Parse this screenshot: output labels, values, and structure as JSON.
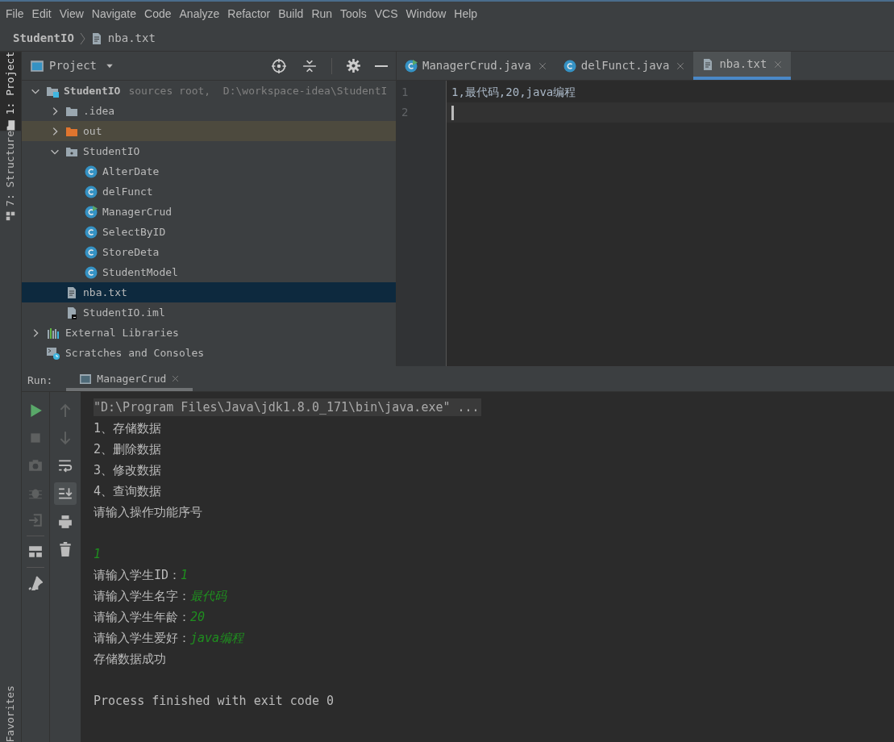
{
  "menu": [
    "File",
    "Edit",
    "View",
    "Navigate",
    "Code",
    "Analyze",
    "Refactor",
    "Build",
    "Run",
    "Tools",
    "VCS",
    "Window",
    "Help"
  ],
  "breadcrumb": {
    "project": "StudentIO",
    "file": "nba.txt"
  },
  "left_strip": [
    {
      "label": "1: Project",
      "selected": true
    },
    {
      "label": "7: Structure",
      "selected": false
    }
  ],
  "favorites": "Favorites",
  "project_panel": {
    "title": "Project",
    "tree": [
      {
        "kind": "module",
        "label": "StudentIO",
        "hint": "sources root,  D:\\workspace-idea\\StudentI",
        "expanded": true,
        "selected": false,
        "children": [
          {
            "kind": "folder",
            "label": ".idea",
            "expanded": false,
            "selected": false
          },
          {
            "kind": "excluded",
            "label": "out",
            "expanded": false,
            "selected": false
          },
          {
            "kind": "source",
            "label": "StudentIO",
            "expanded": true,
            "selected": false,
            "children": [
              {
                "kind": "class",
                "label": "AlterDate",
                "selected": false
              },
              {
                "kind": "class",
                "label": "delFunct",
                "selected": false
              },
              {
                "kind": "main",
                "label": "ManagerCrud",
                "selected": false
              },
              {
                "kind": "class",
                "label": "SelectByID",
                "selected": false
              },
              {
                "kind": "class",
                "label": "StoreDeta",
                "selected": false
              },
              {
                "kind": "class",
                "label": "StudentModel",
                "selected": false
              }
            ]
          },
          {
            "kind": "text",
            "label": "nba.txt",
            "selected": true
          },
          {
            "kind": "iml",
            "label": "StudentIO.iml",
            "selected": false
          }
        ]
      },
      {
        "kind": "libraries",
        "label": "External Libraries",
        "expanded": false,
        "selected": false
      },
      {
        "kind": "scratches",
        "label": "Scratches and Consoles",
        "selected": false
      }
    ]
  },
  "editor": {
    "tabs": [
      {
        "kind": "main",
        "label": "ManagerCrud.java",
        "selected": false
      },
      {
        "kind": "class",
        "label": "delFunct.java",
        "selected": false
      },
      {
        "kind": "text",
        "label": "nba.txt",
        "selected": true
      }
    ],
    "lines": [
      {
        "number": "1",
        "text": "1,最代码,20,java编程"
      },
      {
        "number": "2"
      }
    ]
  },
  "run_panel": {
    "label": "Run:",
    "tab": "ManagerCrud",
    "console": [
      [
        {
          "kind": "command",
          "text": "\"D:\\Program Files\\Java\\jdk1.8.0_171\\bin\\java.exe\" ..."
        }
      ],
      [
        {
          "kind": "output",
          "text": "1、存储数据"
        }
      ],
      [
        {
          "kind": "output",
          "text": "2、删除数据"
        }
      ],
      [
        {
          "kind": "output",
          "text": "3、修改数据"
        }
      ],
      [
        {
          "kind": "output",
          "text": "4、查询数据"
        }
      ],
      [
        {
          "kind": "output",
          "text": "请输入操作功能序号"
        }
      ],
      [
        {
          "kind": "blank"
        }
      ],
      [
        {
          "kind": "input",
          "text": "1"
        }
      ],
      [
        {
          "kind": "output",
          "text": "请输入学生ID："
        },
        {
          "kind": "input",
          "text": "1"
        }
      ],
      [
        {
          "kind": "output",
          "text": "请输入学生名字："
        },
        {
          "kind": "input",
          "text": "最代码"
        }
      ],
      [
        {
          "kind": "output",
          "text": "请输入学生年龄："
        },
        {
          "kind": "input",
          "text": "20"
        }
      ],
      [
        {
          "kind": "output",
          "text": "请输入学生爱好："
        },
        {
          "kind": "input",
          "text": "java编程"
        }
      ],
      [
        {
          "kind": "output",
          "text": "存储数据成功"
        }
      ],
      [
        {
          "kind": "blank"
        }
      ],
      [
        {
          "kind": "output",
          "text": "Process finished with exit code 0"
        }
      ]
    ]
  }
}
